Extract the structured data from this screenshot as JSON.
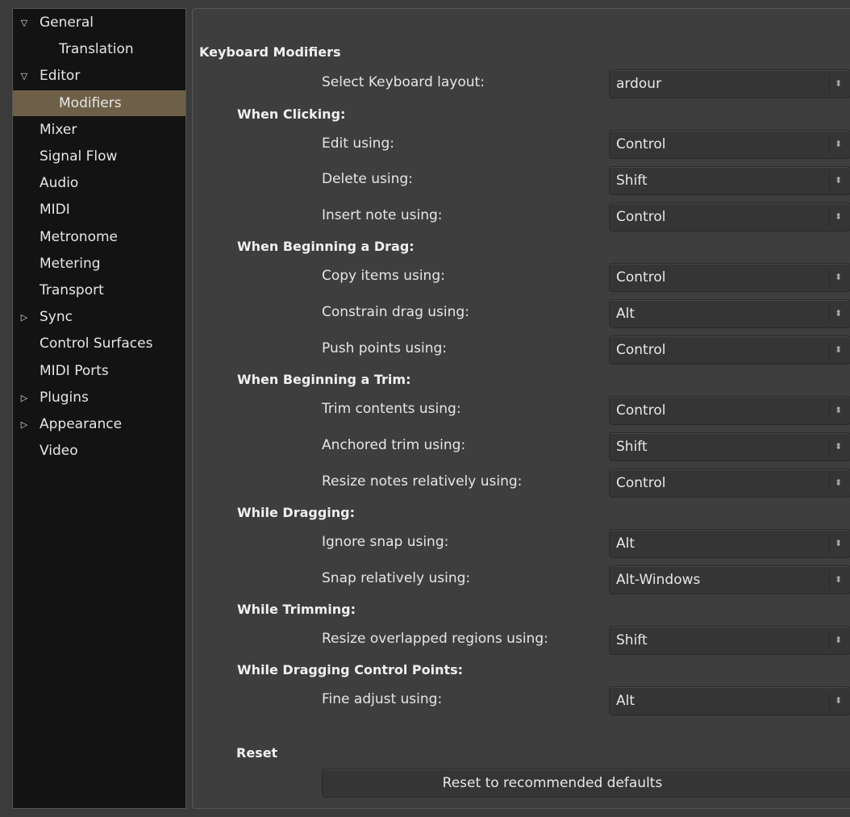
{
  "sidebar": {
    "items": [
      {
        "label": "General",
        "expander": "expanded"
      },
      {
        "label": "Translation",
        "expander": "none"
      },
      {
        "label": "Editor",
        "expander": "expanded"
      },
      {
        "label": "Modifiers",
        "expander": "none",
        "selected": true
      },
      {
        "label": "Mixer",
        "expander": "none"
      },
      {
        "label": "Signal Flow",
        "expander": "none"
      },
      {
        "label": "Audio",
        "expander": "none"
      },
      {
        "label": "MIDI",
        "expander": "none"
      },
      {
        "label": "Metronome",
        "expander": "none"
      },
      {
        "label": "Metering",
        "expander": "none"
      },
      {
        "label": "Transport",
        "expander": "none"
      },
      {
        "label": "Sync",
        "expander": "collapsed"
      },
      {
        "label": "Control Surfaces",
        "expander": "none"
      },
      {
        "label": "MIDI Ports",
        "expander": "none"
      },
      {
        "label": "Plugins",
        "expander": "collapsed"
      },
      {
        "label": "Appearance",
        "expander": "collapsed"
      },
      {
        "label": "Video",
        "expander": "none"
      }
    ]
  },
  "main": {
    "title": "Keyboard Modifiers",
    "layout_label": "Select Keyboard layout:",
    "layout_value": "ardour",
    "groups": [
      {
        "title": "When Clicking:",
        "rows": [
          {
            "label": "Edit using:",
            "value": "Control"
          },
          {
            "label": "Delete using:",
            "value": "Shift"
          },
          {
            "label": "Insert note using:",
            "value": "Control"
          }
        ]
      },
      {
        "title": "When Beginning a Drag:",
        "rows": [
          {
            "label": "Copy items using:",
            "value": "Control"
          },
          {
            "label": "Constrain drag using:",
            "value": "Alt"
          },
          {
            "label": "Push points using:",
            "value": "Control"
          }
        ]
      },
      {
        "title": "When Beginning a Trim:",
        "rows": [
          {
            "label": "Trim contents using:",
            "value": "Control"
          },
          {
            "label": "Anchored trim using:",
            "value": "Shift"
          },
          {
            "label": "Resize notes relatively using:",
            "value": "Control"
          }
        ]
      },
      {
        "title": "While Dragging:",
        "rows": [
          {
            "label": "Ignore snap using:",
            "value": "Alt"
          },
          {
            "label": "Snap relatively using:",
            "value": "Alt-Windows"
          }
        ]
      },
      {
        "title": "While Trimming:",
        "rows": [
          {
            "label": "Resize overlapped regions using:",
            "value": "Shift"
          }
        ]
      },
      {
        "title": "While Dragging Control Points:",
        "rows": [
          {
            "label": "Fine adjust using:",
            "value": "Alt"
          }
        ]
      }
    ],
    "reset_title": "Reset",
    "reset_button": "Reset to recommended defaults"
  },
  "icons": {
    "expanded": "triangle-down-icon",
    "collapsed": "triangle-right-icon",
    "combo_arrow": "up-down-arrows-icon"
  },
  "colors": {
    "selected_bg": "#6e6048",
    "sidebar_bg": "#131313",
    "panel_bg": "#3e3e3e"
  }
}
